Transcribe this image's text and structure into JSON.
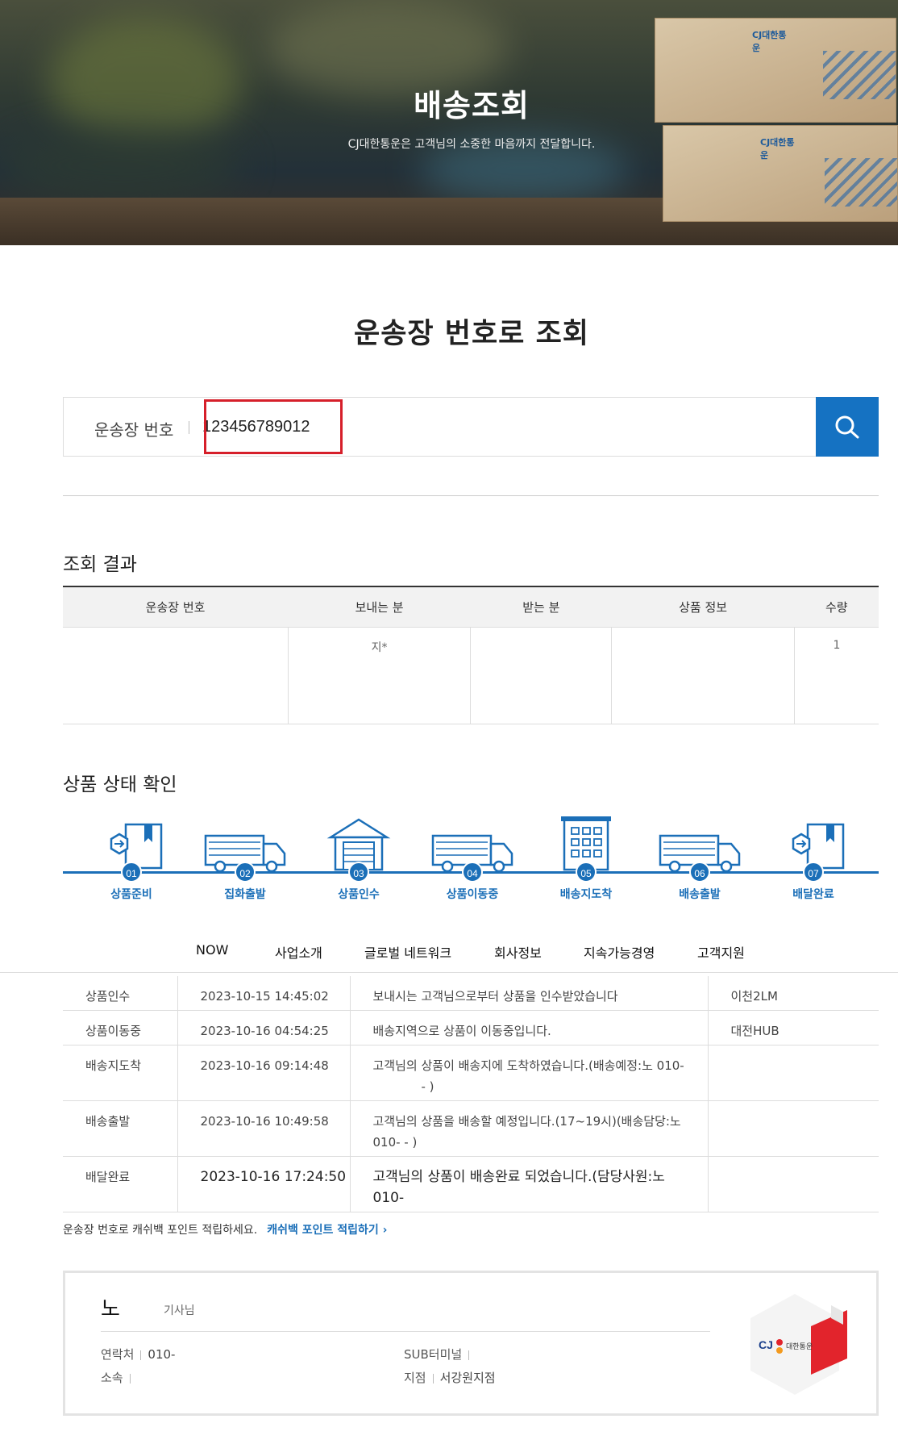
{
  "hero": {
    "title": "배송조회",
    "subtitle": "CJ대한통운은 고객님의 소중한 마음까지 전달합니다.",
    "box_logo": "CJ대한통운"
  },
  "page_title": "운송장 번호로 조회",
  "search": {
    "label": "운송장 번호",
    "value": "123456789012",
    "button_icon": "search-icon"
  },
  "result": {
    "title": "조회 결과",
    "headers": [
      "운송장 번호",
      "보내는 분",
      "받는 분",
      "상품 정보",
      "수량"
    ],
    "row": [
      "",
      "지*",
      "",
      "",
      "1"
    ]
  },
  "status": {
    "title": "상품 상태 확인",
    "steps": [
      {
        "num": "01",
        "label": "상품준비",
        "icon": "box-icon"
      },
      {
        "num": "02",
        "label": "집화출발",
        "icon": "truck-icon"
      },
      {
        "num": "03",
        "label": "상품인수",
        "icon": "warehouse-icon"
      },
      {
        "num": "04",
        "label": "상품이동중",
        "icon": "truck-icon"
      },
      {
        "num": "05",
        "label": "배송지도착",
        "icon": "building-icon"
      },
      {
        "num": "06",
        "label": "배송출발",
        "icon": "truck-icon"
      },
      {
        "num": "07",
        "label": "배달완료",
        "icon": "box-icon"
      }
    ],
    "accent": "#1b6fb8"
  },
  "nav": {
    "items": [
      "NOW",
      "사업소개",
      "글로벌 네트워크",
      "회사정보",
      "지속가능경영",
      "고객지원"
    ]
  },
  "history": [
    {
      "status": "상품인수",
      "time": "2023-10-15 14:45:02",
      "desc": "보내시는 고객님으로부터 상품을 인수받았습니다",
      "desc2": "",
      "loc": "이천2LM"
    },
    {
      "status": "상품이동중",
      "time": "2023-10-16 04:54:25",
      "desc": "배송지역으로 상품이 이동중입니다.",
      "desc2": "",
      "loc": "대전HUB"
    },
    {
      "status": "배송지도착",
      "time": "2023-10-16 09:14:48",
      "desc": "고객님의 상품이 배송지에 도착하였습니다.(배송예정:노        010-",
      "desc2": "-          )",
      "loc": ""
    },
    {
      "status": "배송출발",
      "time": "2023-10-16 10:49:58",
      "desc": "고객님의 상품을 배송할 예정입니다.(17~19시)(배송담당:노",
      "desc2": "010-         -          )",
      "loc": ""
    },
    {
      "status": "배달완료",
      "time": "2023-10-16 17:24:50",
      "desc": "고객님의 상품이 배송완료 되었습니다.(담당사원:노",
      "desc2": "010-",
      "loc": ""
    }
  ],
  "cashback": {
    "text": "운송장 번호로 캐쉬백 포인트 적립하세요.",
    "link": "캐쉬백 포인트 적립하기 ›"
  },
  "driver": {
    "name": "노",
    "role": "기사님",
    "contact_label": "연락처",
    "contact_value": "010-",
    "affiliation_label": "소속",
    "affiliation_value": "",
    "sub_terminal_label": "SUB터미널",
    "sub_terminal_value": "",
    "branch_label": "지점",
    "branch_value": "서강원지점",
    "logo_text": "대한통운",
    "logo_cj": "CJ"
  }
}
